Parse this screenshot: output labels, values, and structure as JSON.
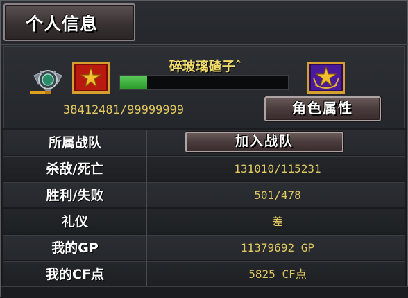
{
  "window": {
    "title": "个人信息"
  },
  "player": {
    "name": "碎玻璃碴子ˆ",
    "xp_text": "38412481/99999999",
    "xp_progress": 0.16,
    "rank_icon": "rank-emblem-icon",
    "current_rank_badge": "red-star-badge-icon",
    "next_rank_badge": "purple-star-badge-icon"
  },
  "buttons": {
    "role_attributes": "角色属性",
    "join_team": "加入战队"
  },
  "stats": [
    {
      "label": "所属战队",
      "value": ""
    },
    {
      "label": "杀敌/死亡",
      "value": "131010/115231"
    },
    {
      "label": "胜利/失败",
      "value": "501/478"
    },
    {
      "label": "礼仪",
      "value": "差"
    },
    {
      "label": "我的GP",
      "value": "11379692 GP"
    },
    {
      "label": "我的CF点",
      "value": "5825 CF点"
    }
  ],
  "colors": {
    "value_text": "#e2c860",
    "name_text": "#f2dc6a",
    "xp_fill": "#3aaa3a"
  }
}
